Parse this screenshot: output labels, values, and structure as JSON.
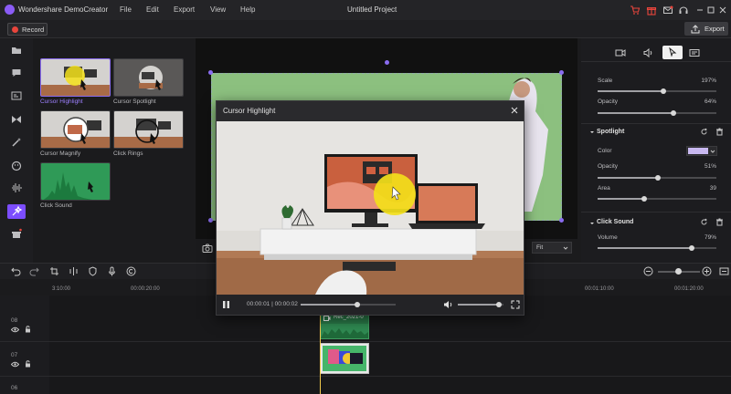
{
  "app": {
    "name": "Wondershare DemoCreator",
    "document_title": "Untitled Project"
  },
  "menu": [
    "File",
    "Edit",
    "Export",
    "View",
    "Help"
  ],
  "toolbar": {
    "record_label": "Record",
    "export_label": "Export"
  },
  "effects": [
    {
      "label": "Cursor Highlight",
      "selected": true
    },
    {
      "label": "Cursor Spotlight",
      "selected": false
    },
    {
      "label": "Cursor Magnify",
      "selected": false
    },
    {
      "label": "Click Rings",
      "selected": false
    },
    {
      "label": "Click Sound",
      "selected": false
    }
  ],
  "preview": {
    "zoom": "Fit"
  },
  "properties": {
    "scale_label": "Scale",
    "scale_value": "197%",
    "scale_fraction": 0.55,
    "opacity_label": "Opacity",
    "opacity_value": "64%",
    "opacity_fraction": 0.64,
    "spotlight_title": "Spotlight",
    "color_label": "Color",
    "color_value": "#c8b8f0",
    "sp_opacity_label": "Opacity",
    "sp_opacity_value": "51%",
    "sp_opacity_fraction": 0.51,
    "area_label": "Area",
    "area_value": "39",
    "area_fraction": 0.39,
    "click_sound_title": "Click Sound",
    "volume_label": "Volume",
    "volume_value": "79%",
    "volume_fraction": 0.79
  },
  "timeline": {
    "ruler": [
      "3:10:00",
      "00:00:20:00",
      "00:01:10:00",
      "00:01:20:00"
    ],
    "tracks": [
      "08",
      "07",
      "06"
    ],
    "clip_label": "Rec_2021-0"
  },
  "modal": {
    "title": "Cursor Highlight",
    "time": "00:00:01 | 00:00:02",
    "progress_fraction": 0.6,
    "volume_fraction": 0.9
  },
  "colors": {
    "accent": "#7c4dff",
    "canvas_green": "#8cc07f",
    "highlight_yellow": "#f3e01a",
    "playhead": "#f2c94c"
  }
}
